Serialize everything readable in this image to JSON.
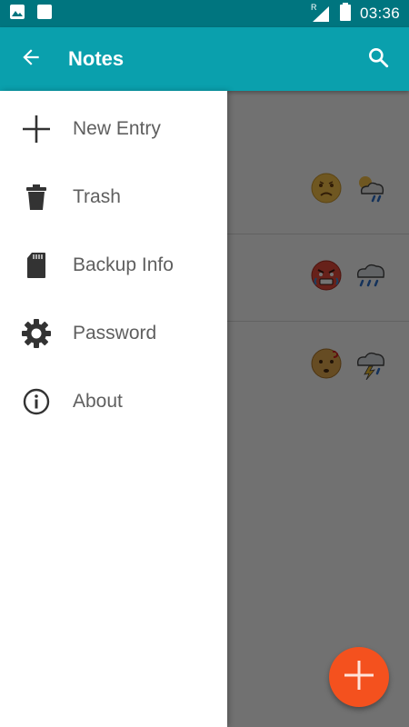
{
  "status_bar": {
    "time": "03:36",
    "icons": [
      "image-icon",
      "square-notification-icon",
      "signal-icon",
      "battery-icon"
    ],
    "signal_label": "R"
  },
  "app_bar": {
    "title": "Notes",
    "back_icon": "arrow-left-icon",
    "search_icon": "search-icon",
    "color": "#0aa0ad"
  },
  "drawer": {
    "items": [
      {
        "label": "New Entry",
        "icon": "plus-icon"
      },
      {
        "label": "Trash",
        "icon": "trash-icon"
      },
      {
        "label": "Backup Info",
        "icon": "sd-card-icon"
      },
      {
        "label": "Password",
        "icon": "gear-icon"
      },
      {
        "label": "About",
        "icon": "info-icon"
      }
    ]
  },
  "entries": [
    {
      "mood_icon": "sad-face-icon",
      "weather_icon": "partly-cloudy-rain-icon"
    },
    {
      "mood_icon": "angry-face-icon",
      "weather_icon": "rain-cloud-icon"
    },
    {
      "mood_icon": "confused-face-icon",
      "weather_icon": "thunderstorm-icon"
    }
  ],
  "fab": {
    "icon": "plus-icon",
    "color": "#f4511e"
  }
}
